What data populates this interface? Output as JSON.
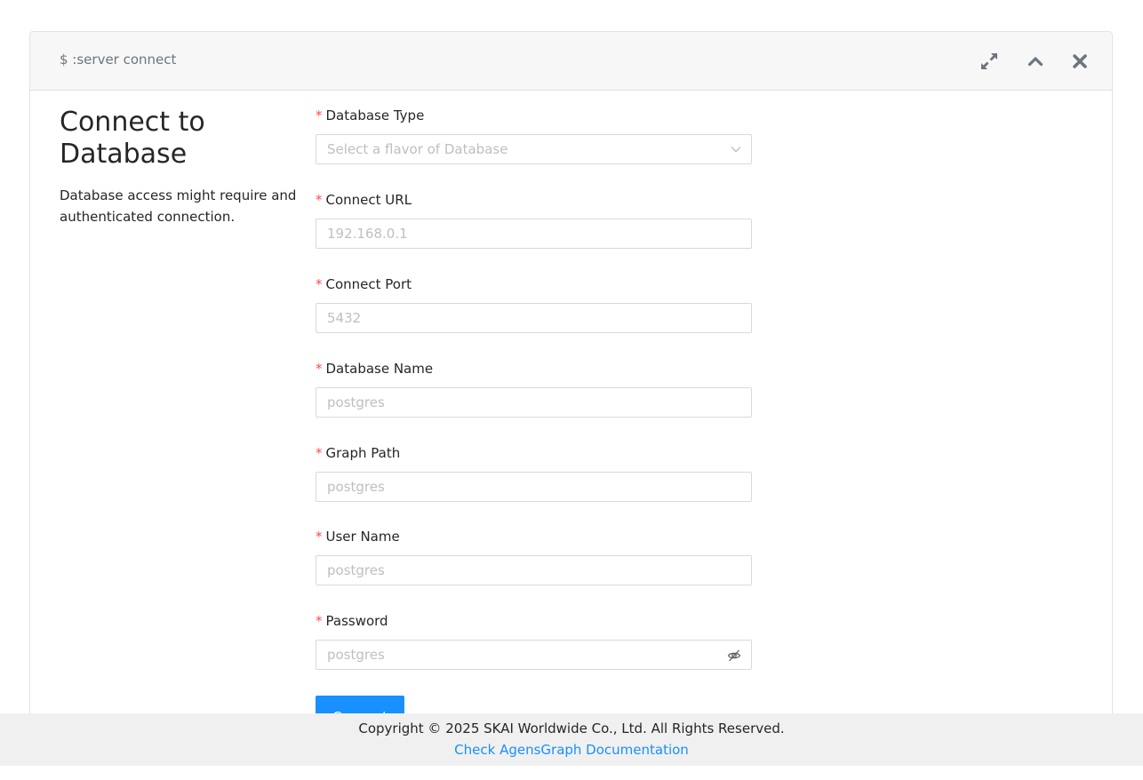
{
  "header": {
    "command": "$ :server connect",
    "icons": [
      "expand-icon",
      "chevron-up-icon",
      "close-icon"
    ]
  },
  "side": {
    "title": "Connect to Database",
    "description": "Database access might require and authenticated connection."
  },
  "form": {
    "required_marker": "*",
    "fields": [
      {
        "label": "Database Type",
        "placeholder": "Select a flavor of Database",
        "kind": "select"
      },
      {
        "label": "Connect URL",
        "placeholder": "192.168.0.1",
        "kind": "text"
      },
      {
        "label": "Connect Port",
        "placeholder": "5432",
        "kind": "text"
      },
      {
        "label": "Database Name",
        "placeholder": "postgres",
        "kind": "text"
      },
      {
        "label": "Graph Path",
        "placeholder": "postgres",
        "kind": "text"
      },
      {
        "label": "User Name",
        "placeholder": "postgres",
        "kind": "text"
      },
      {
        "label": "Password",
        "placeholder": "postgres",
        "kind": "password"
      }
    ],
    "submit_label": "Connect"
  },
  "footer": {
    "copyright": "Copyright © 2025 SKAI Worldwide Co., Ltd. All Rights Reserved.",
    "doc_link": "Check AgensGraph Documentation"
  },
  "colors": {
    "accent": "#1890ff",
    "required": "#ff4d4f",
    "placeholder": "#bfbfbf",
    "header_bg": "#f7f7f7",
    "footer_bg": "#f0f0f0"
  }
}
